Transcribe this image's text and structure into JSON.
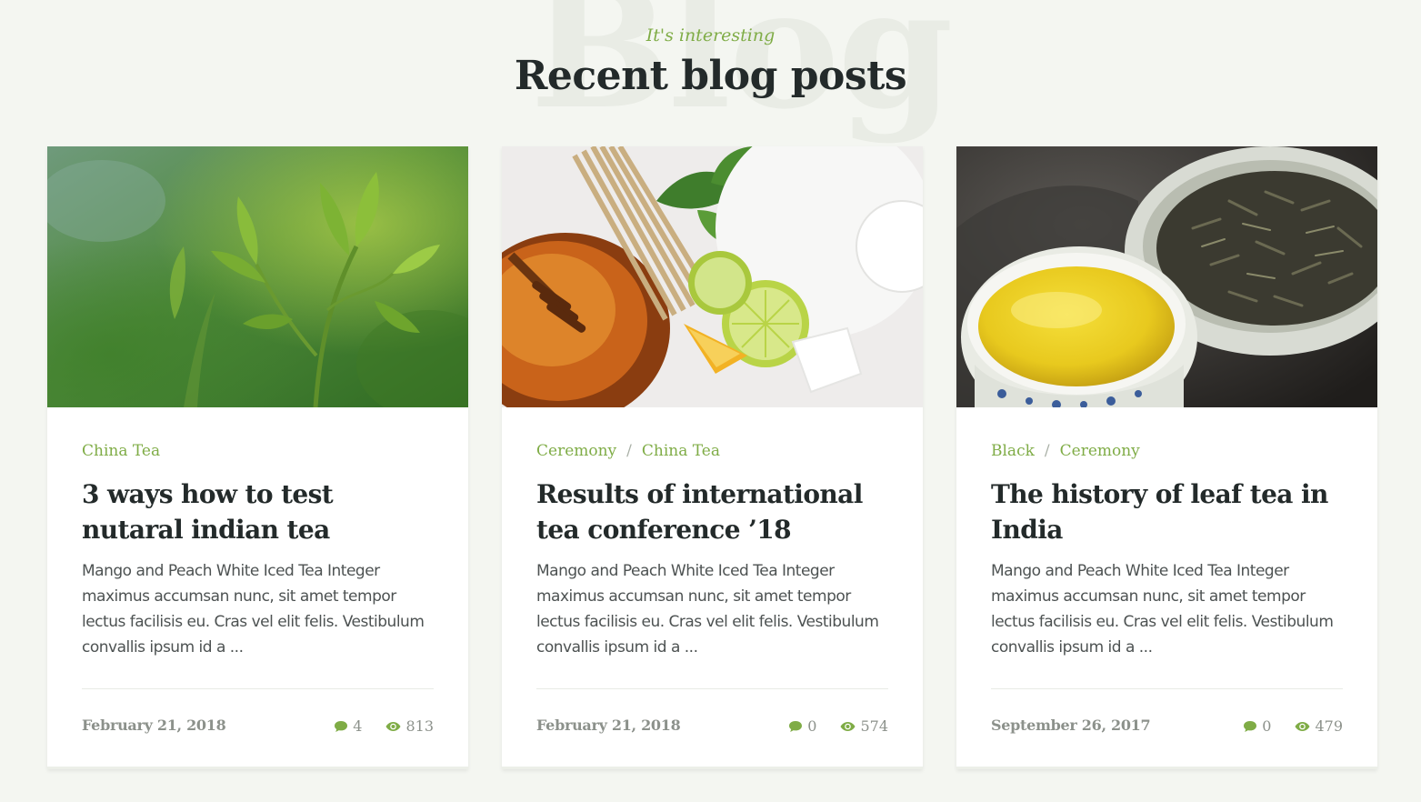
{
  "section": {
    "background_word": "Blog",
    "kicker": "It's interesting",
    "title": "Recent blog posts"
  },
  "posts": [
    {
      "image": "tea-sprout-photo",
      "categories": [
        "China Tea"
      ],
      "title": "3 ways how to test nutaral indian tea",
      "excerpt": "Mango and Peach White Iced Tea Integer maximus accumsan nunc, sit amet tempor lectus facilisis eu. Cras vel elit felis. Vestibulum convallis ipsum id a ...",
      "date": "February 21, 2018",
      "comments": "4",
      "views": "813"
    },
    {
      "image": "honey-lime-mint-photo",
      "categories": [
        "Ceremony",
        "China Tea"
      ],
      "title": "Results of international tea conference ’18",
      "excerpt": "Mango and Peach White Iced Tea Integer maximus accumsan nunc, sit amet tempor lectus facilisis eu. Cras vel elit felis. Vestibulum convallis ipsum id a ...",
      "date": "February 21, 2018",
      "comments": "0",
      "views": "574"
    },
    {
      "image": "tea-cups-photo",
      "categories": [
        "Black",
        "Ceremony"
      ],
      "title": "The history of leaf tea in India",
      "excerpt": "Mango and Peach White Iced Tea Integer maximus accumsan nunc, sit amet tempor lectus facilisis eu. Cras vel elit felis. Vestibulum convallis ipsum id a ...",
      "date": "September 26, 2017",
      "comments": "0",
      "views": "479"
    }
  ],
  "category_separator": "/",
  "icons": {
    "comments": "comment-icon",
    "views": "eye-icon"
  },
  "colors": {
    "accent": "#7fac46",
    "heading": "#232a2a",
    "page_background": "#f4f6f1",
    "muted": "#8c918b"
  }
}
